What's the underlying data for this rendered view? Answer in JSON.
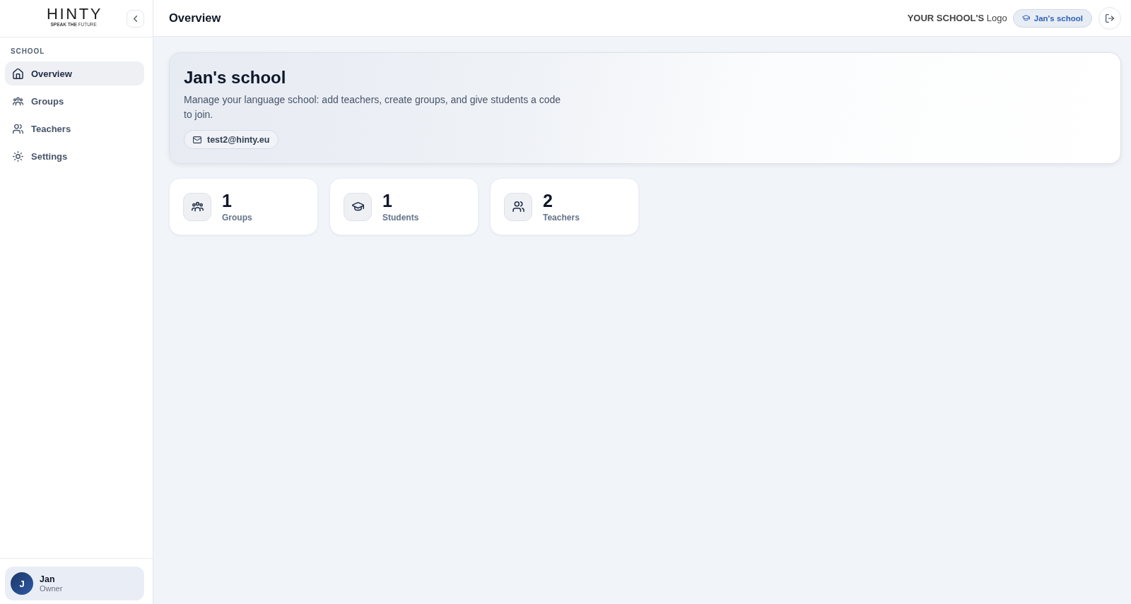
{
  "sidebar": {
    "logo": {
      "wordmark": "HINTY",
      "tagline": "**SPEAK THE** FUTURE"
    },
    "section_label": "SCHOOL",
    "items": [
      {
        "label": "Overview",
        "selected": true
      },
      {
        "label": "Groups",
        "selected": false
      },
      {
        "label": "Teachers",
        "selected": false
      },
      {
        "label": "Settings",
        "selected": false
      }
    ],
    "user": {
      "initial": "J",
      "name": "Jan",
      "role": "Owner"
    }
  },
  "header": {
    "title": "Overview",
    "school_logo": "**YOUR SCHOOL'S** Logo",
    "school_badge": "Jan's school"
  },
  "hero": {
    "title": "Jan's school",
    "description": "Manage your language school: add teachers, create groups, and give students a code to join.",
    "email": "test2@hinty.eu"
  },
  "stats": [
    {
      "value": "1",
      "label": "Groups"
    },
    {
      "value": "1",
      "label": "Students"
    },
    {
      "value": "2",
      "label": "Teachers"
    }
  ]
}
